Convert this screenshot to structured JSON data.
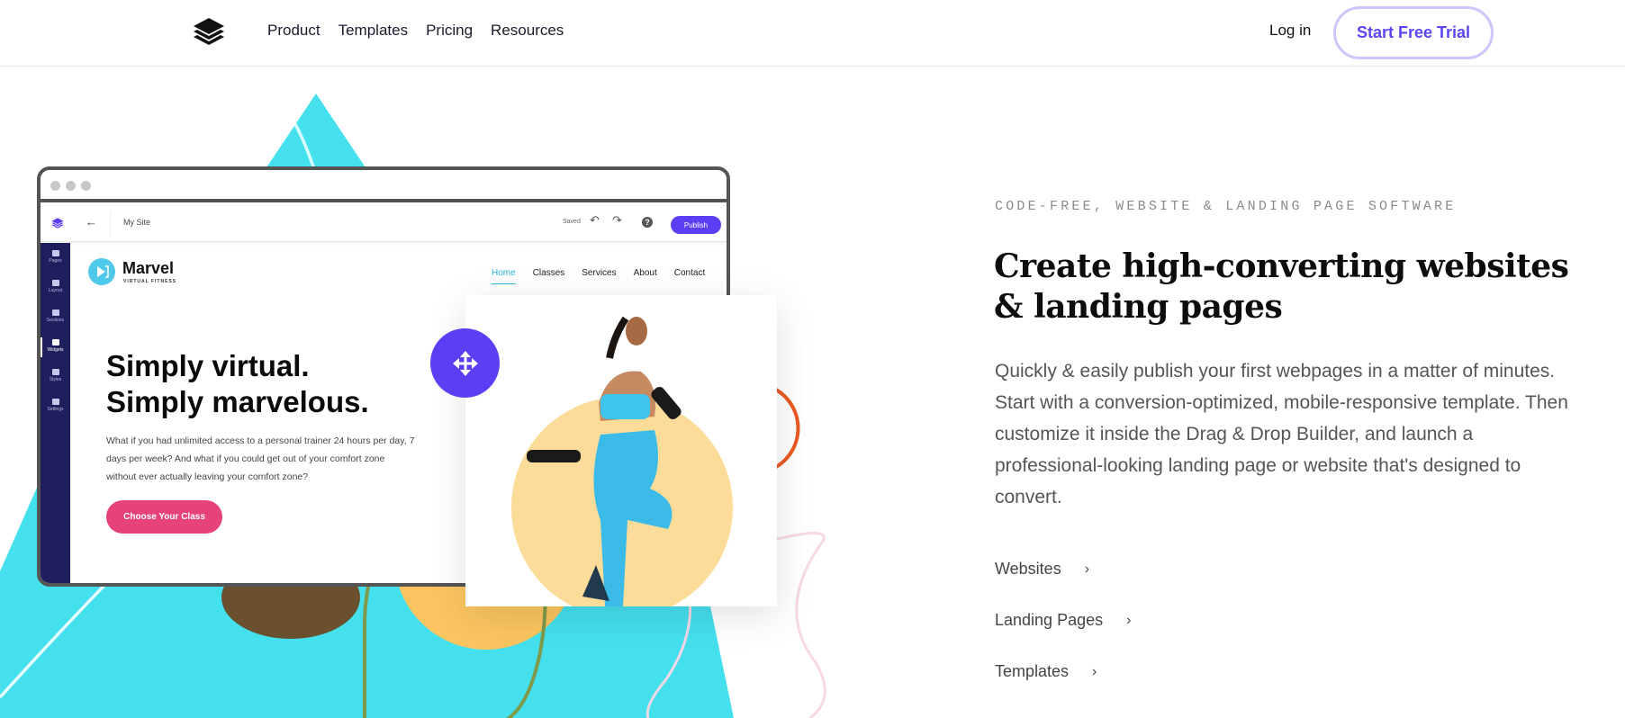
{
  "header": {
    "logo_icon": "stacked-layers-icon",
    "nav": [
      "Product",
      "Templates",
      "Pricing",
      "Resources"
    ],
    "login_label": "Log in",
    "cta_label": "Start Free Trial",
    "cta_color": "#5b45f0",
    "cta_border_color": "#cfc4fb"
  },
  "mockup": {
    "builder": {
      "logo_icon": "stacked-layers-icon",
      "back_icon": "←",
      "site_name": "My Site",
      "status": "Saved",
      "undo_icon": "↶",
      "redo_icon": "↷",
      "help_icon": "?",
      "publish_label": "Publish",
      "accent": "#5b3ff5"
    },
    "sidebar": [
      {
        "label": "Pages",
        "icon": "pages-icon"
      },
      {
        "label": "Layout",
        "icon": "layers-icon"
      },
      {
        "label": "Sections",
        "icon": "sections-icon"
      },
      {
        "label": "Widgets",
        "icon": "widgets-icon",
        "active": true
      },
      {
        "label": "Styles",
        "icon": "brush-icon"
      },
      {
        "label": "Settings",
        "icon": "gear-icon"
      }
    ],
    "site": {
      "brand_name": "Marvel",
      "brand_tagline": "VIRTUAL FITNESS",
      "nav": [
        "Home",
        "Classes",
        "Services",
        "About",
        "Contact"
      ],
      "active_nav": "Home",
      "headline_line1": "Simply virtual.",
      "headline_line2": "Simply marvelous.",
      "body": "What if you had unlimited access to a personal trainer 24 hours per day, 7 days per week? And what if you could get out of your comfort zone without ever actually leaving your comfort zone?",
      "cta_label": "Choose Your Class",
      "cta_color": "#e8427a"
    },
    "move_handle_icon": "move-arrows-icon"
  },
  "hero": {
    "eyebrow": "CODE-FREE, WEBSITE & LANDING PAGE SOFTWARE",
    "headline": "Create high-converting websites & landing pages",
    "lead": "Quickly & easily publish your first webpages in a matter of minutes. Start with a conversion-optimized, mobile-responsive template. Then customize it inside the Drag & Drop Builder, and launch a professional-looking landing page or website that's designed to convert.",
    "links": [
      {
        "label": "Websites",
        "icon": "chevron-right-icon"
      },
      {
        "label": "Landing Pages",
        "icon": "chevron-right-icon"
      },
      {
        "label": "Templates",
        "icon": "chevron-right-icon"
      }
    ],
    "chevron_glyph": "›"
  }
}
